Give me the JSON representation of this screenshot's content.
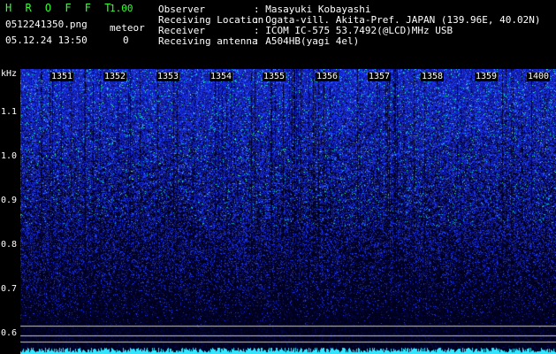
{
  "header": {
    "brand": "H R O F F T",
    "version": "1.00",
    "filename": "0512241350.png",
    "timestamp": "05.12.24 13:50",
    "meteor_label": "meteor",
    "meteor_count": "0",
    "observer_label": "Observer",
    "observer_value": ": Masayuki Kobayashi",
    "location_label": "Receiving Location",
    "location_value": ": Ogata-vill. Akita-Pref. JAPAN (139.96E, 40.02N)",
    "receiver_label": "Receiver",
    "receiver_value": ": ICOM IC-575 53.7492(@LCD)MHz USB",
    "antenna_label": "Receiving antenna",
    "antenna_value": ": A504HB(yagi 4el)"
  },
  "axis": {
    "unit": "kHz",
    "yticks": [
      "1.1",
      "1.0",
      "0.9",
      "0.8",
      "0.7",
      "0.6"
    ],
    "xticks": [
      "1351",
      "1352",
      "1353",
      "1354",
      "1355",
      "1356",
      "1357",
      "1358",
      "1359",
      "1400"
    ]
  },
  "colors": {
    "text": "#ffffff",
    "brand": "#33ff33",
    "bg": "#000000",
    "signal": "#2a3cff",
    "strong": "#39ff7a"
  }
}
